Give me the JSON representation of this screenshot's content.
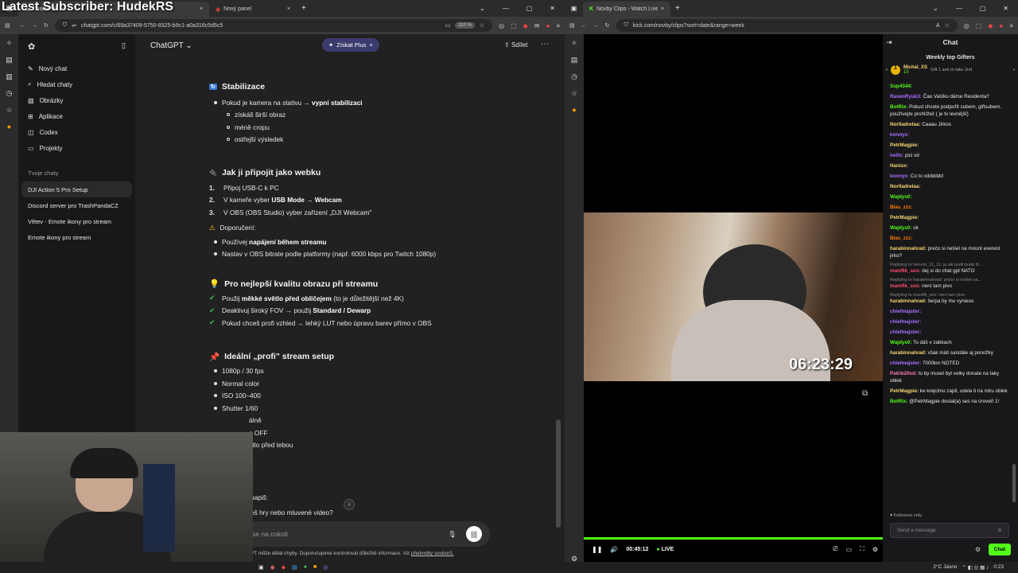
{
  "overlay_title": "Latest Subscriber: HudekRS",
  "left_browser": {
    "tabs": [
      {
        "label": "ChatGPT"
      },
      {
        "label": "Nový panel"
      }
    ],
    "url": "chatgpt.com/c/69a37409-5750-8325-b9c1-a0a316c5d5c5",
    "zoom": "110 %"
  },
  "sidebar": {
    "items": [
      {
        "label": "Nový chat",
        "icon": "compose-icon"
      },
      {
        "label": "Hledat chaty",
        "icon": "search-icon"
      },
      {
        "label": "Obrázky",
        "icon": "image-icon"
      },
      {
        "label": "Aplikace",
        "icon": "apps-icon"
      },
      {
        "label": "Codex",
        "icon": "codex-icon"
      },
      {
        "label": "Projekty",
        "icon": "folder-icon"
      }
    ],
    "section_title": "Tvoje chaty",
    "chats": [
      {
        "label": "DJI Action 5 Pro Setup"
      },
      {
        "label": "Discord server pro TrashPandaCZ"
      },
      {
        "label": "Větev - Emote ikony pro stream"
      },
      {
        "label": "Emote ikony pro stream"
      }
    ]
  },
  "header": {
    "model": "ChatGPT",
    "plus_label": "Získat Plus",
    "share_label": "Sdílet"
  },
  "content": {
    "stab_title": "Stabilizace",
    "stab_pre": "Pokud je kamera na stativu → ",
    "stab_bold": "vypni stabilizaci",
    "stab_subs": [
      "získáš širší obraz",
      "méně cropu",
      "ostřejší výsledek"
    ],
    "web_title": "Jak ji připojit jako webku",
    "web_steps": [
      "1.",
      "2.",
      "3."
    ],
    "web_1": "Připoj USB-C k PC",
    "web_2_pre": "V kameře vyber ",
    "web_2_bold": "USB Mode → Webcam",
    "web_3": "V OBS (OBS Studio) vyber zařízení „DJI Webcam\"",
    "tip_label": "Doporučení:",
    "tip_1_pre": "Používej ",
    "tip_1_bold": "napájení během streamu",
    "tip_2": "Nastav v OBS bitrate podle platformy (např. 6000 kbps pro Twitch 1080p)",
    "best_title": "Pro nejlepší kvalitu obrazu při streamu",
    "best_1_pre": "Použij ",
    "best_1_bold": "měkké světlo před obličejem",
    "best_1_post": " (to je důležitější než 4K)",
    "best_2_pre": "Deaktivuj široký FOV → použij ",
    "best_2_bold": "Standard / Dewarp",
    "best_3": "Pokud chceš profi vzhled → lehký LUT nebo úpravu barev přímo v OBS",
    "setup_title": "Ideální „profi\" stream setup",
    "setup_items": [
      "1080p / 30 fps",
      "Normal color",
      "ISO 100–400",
      "Shutter 1/60",
      "álně",
      "e OFF",
      "ětlo před tebou"
    ],
    "partial_1": "napiš:",
    "partial_2": "eš hry nebo mluvené video?",
    "composer_placeholder": "se na cokoli",
    "disclaimer": "PT může dělat chyby. Doporučujeme kontrolovat důležité informace. Viz ",
    "disclaimer_link": "předvolby souborů."
  },
  "right_browser": {
    "tab_label": "Novby Clips - Watch Live o",
    "url": "kick.com/novby/clips?sort=date&range=week"
  },
  "video": {
    "timestamp": "06:23:29",
    "elapsed": "00:45:12",
    "live_label": "LIVE",
    "progress": 1.0
  },
  "chat": {
    "title": "Chat",
    "gifters_title": "Weekly top Gifters",
    "top_gifter": "Michal_XS",
    "top_gifter_count": "15",
    "gift_hint": "Gift 1 sub to take 2nd",
    "messages": [
      {
        "user": "Sup4344:",
        "color": "#53fc18",
        "text": ""
      },
      {
        "user": "RavenRyuk3:",
        "color": "#a970ff",
        "text": " Čau Vašíku dáme Residenta?"
      },
      {
        "user": "BotRix:",
        "color": "#53fc18",
        "text": " Pokud chcete podpořit subem, giftsubem, používejte prohlížeč ( je to levnější)"
      },
      {
        "user": "Norlladrelaa:",
        "color": "#f5d76e",
        "text": " Caaau Jirkos"
      },
      {
        "user": "konnyx:",
        "color": "#a970ff",
        "text": ""
      },
      {
        "user": "PetrMagpie:",
        "color": "#f5d76e",
        "text": ""
      },
      {
        "user": "helfo:",
        "color": "#a970ff",
        "text": " pici xd"
      },
      {
        "user": "Hanisx:",
        "color": "#f5d76e",
        "text": ""
      },
      {
        "user": "konnyx:",
        "color": "#a970ff",
        "text": " Co to xdddddd"
      },
      {
        "user": "Norlladrelaa:",
        "color": "#f5d76e",
        "text": ""
      },
      {
        "user": "Wajdys0:",
        "color": "#53fc18",
        "text": ""
      },
      {
        "user": "Blas_zzz:",
        "color": "#ff7a00",
        "text": ""
      },
      {
        "user": "PetrMagpie:",
        "color": "#f5d76e",
        "text": ""
      },
      {
        "user": "Wajdys0:",
        "color": "#53fc18",
        "text": " ok"
      },
      {
        "user": "Blas_zzz:",
        "color": "#ff7a00",
        "text": ""
      },
      {
        "user": "harabinnahrad:",
        "color": "#f5d76e",
        "text": " prečo si nešiel na mount everest jirko?"
      },
      {
        "user": "Replying to Venom_11_11: ja ale jestli bude th...",
        "color": "#8a8a8a",
        "text": "",
        "reply": true
      },
      {
        "user": "manifik_sos:",
        "color": "#ff4d6d",
        "text": " dej si do chat gpt NATO"
      },
      {
        "user": "Replying to harabinnahrad: prečo si nešiel na...",
        "color": "#8a8a8a",
        "text": "",
        "reply": true
      },
      {
        "user": "manifik_sos:",
        "color": "#ff4d6d",
        "text": " není tam pivo"
      },
      {
        "user": "Replying to manifik_sos: není tam pivo",
        "color": "#8a8a8a",
        "text": "",
        "reply": true
      },
      {
        "user": "harabinnahrad:",
        "color": "#f5d76e",
        "text": " šerpa by mu vynieso"
      },
      {
        "user": "chiefmajster:",
        "color": "#a970ff",
        "text": ""
      },
      {
        "user": "chiefmajster:",
        "color": "#a970ff",
        "text": ""
      },
      {
        "user": "chiefmajster:",
        "color": "#a970ff",
        "text": ""
      },
      {
        "user": "Wajdys0:",
        "color": "#53fc18",
        "text": " To dáš v zabkach"
      },
      {
        "user": "harabinnahrad:",
        "color": "#f5d76e",
        "text": " však máš sandále aj ponožky"
      },
      {
        "user": "chiefmajster:",
        "color": "#a970ff",
        "text": " 7000km NOTED"
      },
      {
        "user": "Patrik20xd:",
        "color": "#ff7ab6",
        "text": " to by musel byt velky donate na taky oblek"
      },
      {
        "user": "PetrMagpie:",
        "color": "#f5d76e",
        "text": " ke krejcimu zajdi, udela ti na miru oblek"
      },
      {
        "user": "BotRix:",
        "color": "#53fc18",
        "text": " @PetrMagpie dostal(a) ses na úroveň 1!"
      }
    ],
    "followers_only": "Followers only",
    "input_placeholder": "Send a message",
    "send_label": "Chat"
  },
  "taskbar": {
    "weather": "2°C  Jasno",
    "time": "0:23"
  }
}
